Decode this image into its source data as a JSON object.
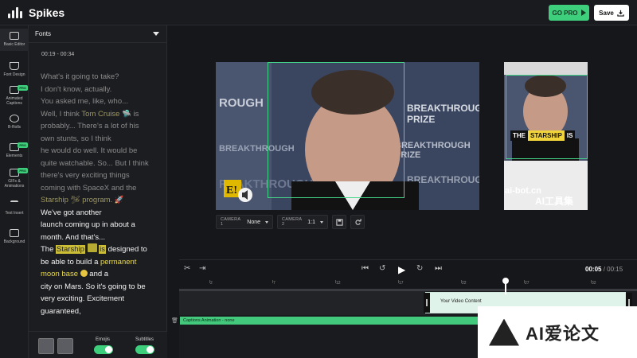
{
  "app": {
    "name": "Spikes"
  },
  "toolbar": {
    "gopro_label": "GO PRO",
    "save_label": "Save"
  },
  "rail": {
    "items": [
      {
        "label": "Basic Editor",
        "pro": false
      },
      {
        "label": "Font Design",
        "pro": false
      },
      {
        "label": "Animated Captions",
        "pro": true
      },
      {
        "label": "B-Rolls",
        "pro": false
      },
      {
        "label": "Elements",
        "pro": true
      },
      {
        "label": "GIFs & Animations",
        "pro": true
      },
      {
        "label": "Text Insert",
        "pro": false
      },
      {
        "label": "Background",
        "pro": false
      }
    ]
  },
  "panel": {
    "title": "Fonts",
    "time_range": "00:19 - 00:34",
    "lines": {
      "l1": "What's it going to take?",
      "l2": "I don't know, actually.",
      "l3": "You asked me, like, who...",
      "l4a": "Well, I think ",
      "l4b": "Tom Cruise",
      "l4c": " 🛸 is",
      "l5": "probably... There's a lot of his",
      "l6": "own stunts, so I think",
      "l7": "he would do well. It would be",
      "l8": "quite watchable. So... But I think",
      "l9": "there's very exciting things",
      "l10": "coming with SpaceX and the",
      "l11a": "Starship",
      "l11b": " 🛩 program. 🚀",
      "l12": "We've got another",
      "l13": "launch coming up in about a",
      "l14": "month. And that's...",
      "l15a": "The ",
      "l15b": "Starship",
      "l15c": "is",
      "l15d": " designed to",
      "l16a": "be able to build a ",
      "l16b": "permanent",
      "l17a": "moon base",
      "l17b": " and a",
      "l18": "city on Mars. So it's going to be",
      "l19": "very exciting. Excitement",
      "l20": "guaranteed,"
    },
    "footer": {
      "emojis_label": "Emojis",
      "subtitles_label": "Subtitles"
    }
  },
  "video": {
    "backdrop_text": "BREAKTHROUGH PRIZE",
    "preview_caption": {
      "w1": "THE",
      "w2": "STARSHIP",
      "w3": "IS"
    },
    "badge": "E!"
  },
  "watermark_overlay": {
    "line1": "ai-bot.cn",
    "line2": "AI工具集"
  },
  "camera": {
    "cam1_label": "CAMERA 1",
    "cam1_value": "None",
    "cam2_label": "CAMERA 2",
    "cam2_value": "1:1"
  },
  "transport": {
    "current": "00:05",
    "separator": " / ",
    "total": "00:15"
  },
  "timeline": {
    "ticks": [
      "2",
      "7",
      "12",
      "17",
      "22",
      "27",
      "32"
    ],
    "video_track_label": "Your Video Content",
    "caption_track_label": "Captions Animation - none"
  },
  "corner_watermark": {
    "text": "AI爱论文"
  },
  "colors": {
    "accent": "#3ecf7d",
    "highlight": "#cbbd35"
  }
}
